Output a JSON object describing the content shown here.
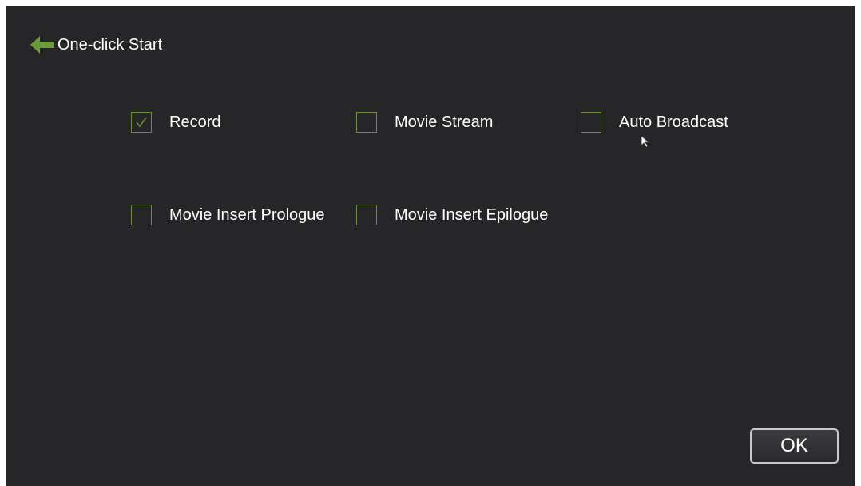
{
  "header": {
    "back_icon": "arrow-left-icon",
    "title": "One-click Start"
  },
  "options": [
    {
      "label": "Record",
      "checked": true
    },
    {
      "label": "Movie Stream",
      "checked": false
    },
    {
      "label": "Auto Broadcast",
      "checked": false
    },
    {
      "label": "Movie Insert Prologue",
      "checked": false
    },
    {
      "label": "Movie Insert Epilogue",
      "checked": false
    }
  ],
  "ok_button": {
    "label": "OK"
  },
  "colors": {
    "background": "#262628",
    "accent": "#6d8c3e",
    "text": "#ffffff"
  }
}
